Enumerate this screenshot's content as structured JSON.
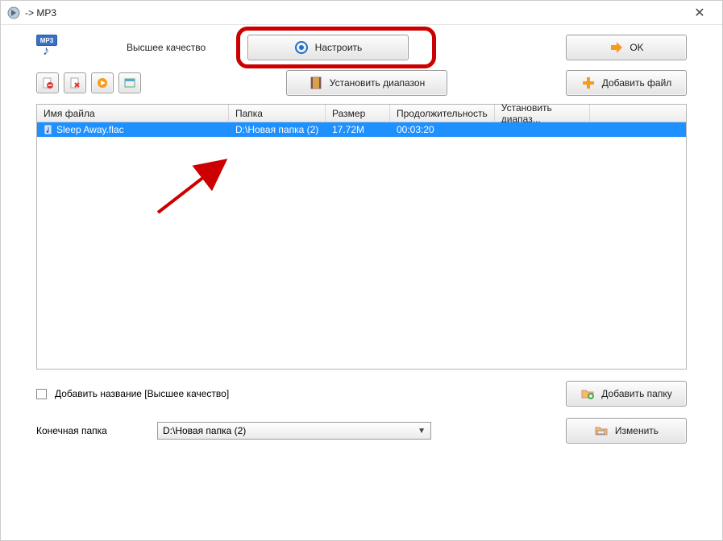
{
  "titlebar": {
    "title": " -> MP3"
  },
  "top": {
    "mp3_label": "MP3",
    "quality": "Высшее качество",
    "configure_label": "Настроить",
    "ok_label": "OK"
  },
  "toolbar": {
    "range_label": "Установить диапазон",
    "add_file_label": "Добавить файл"
  },
  "table": {
    "headers": {
      "name": "Имя файла",
      "folder": "Папка",
      "size": "Размер",
      "duration": "Продолжительность",
      "range": "Установить диапаз..."
    },
    "rows": [
      {
        "name": "Sleep Away.flac",
        "folder": "D:\\Новая папка (2)",
        "size": "17.72M",
        "duration": "00:03:20",
        "range": ""
      }
    ]
  },
  "bottom": {
    "add_name_label": "Добавить название [Высшее качество]",
    "dest_label": "Конечная папка",
    "dest_value": "D:\\Новая папка (2)",
    "add_folder_label": "Добавить папку",
    "change_label": "Изменить"
  }
}
